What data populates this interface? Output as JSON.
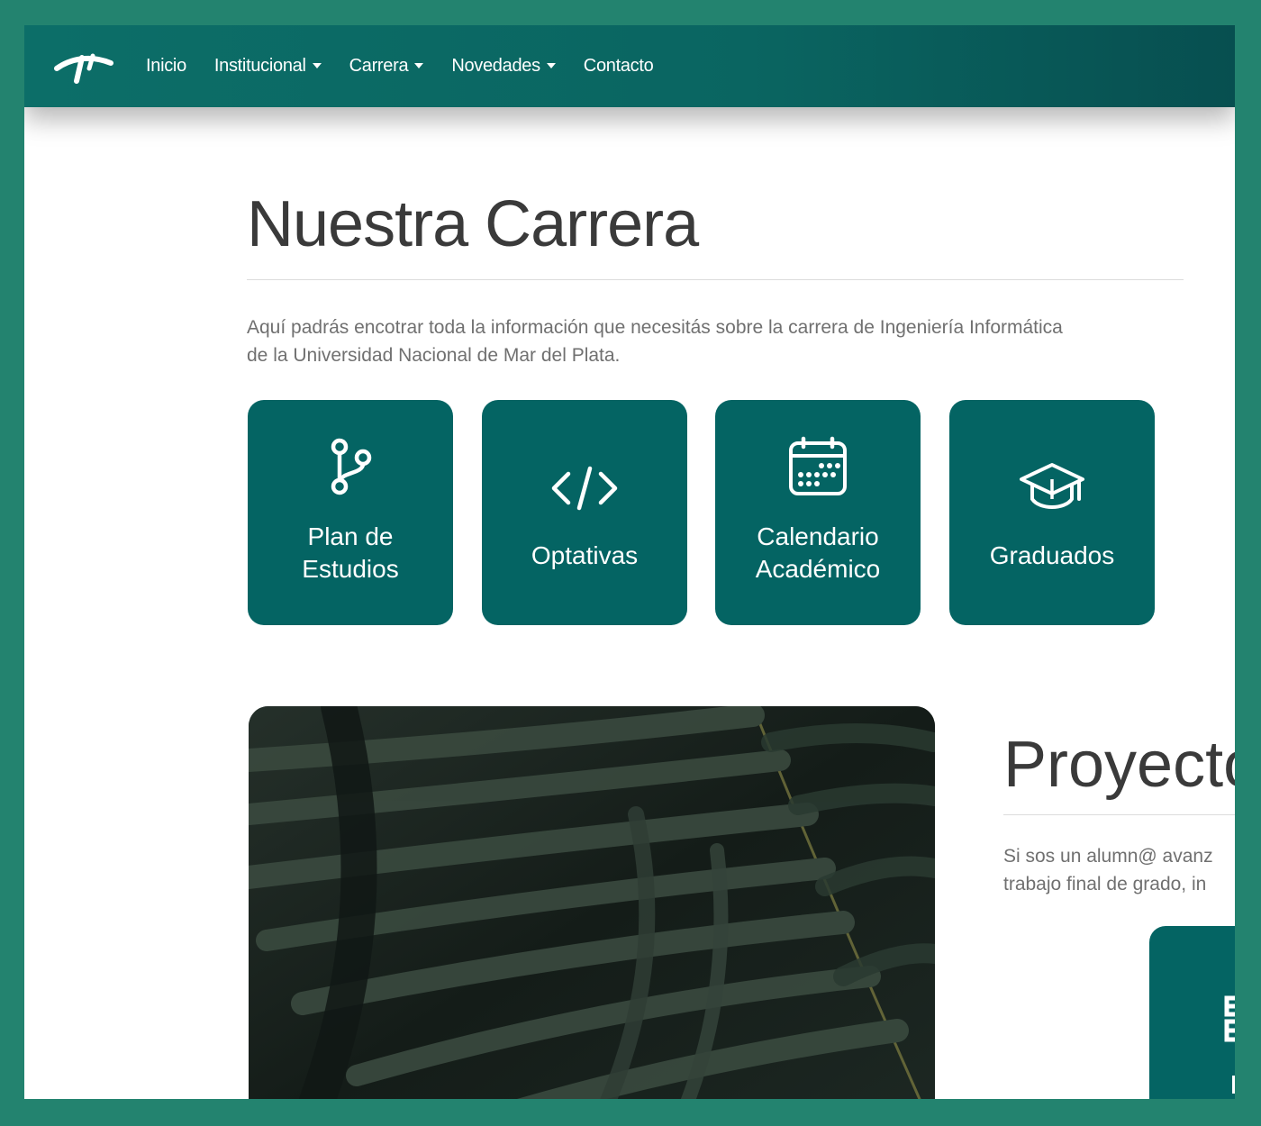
{
  "nav": {
    "logo": "logo-icon",
    "items": [
      {
        "label": "Inicio",
        "dropdown": false
      },
      {
        "label": "Institucional",
        "dropdown": true
      },
      {
        "label": "Carrera",
        "dropdown": true
      },
      {
        "label": "Novedades",
        "dropdown": true
      },
      {
        "label": "Contacto",
        "dropdown": false
      }
    ]
  },
  "main": {
    "title": "Nuestra Carrera",
    "intro_line1": "Aquí padrás encotrar toda la información que necesitás sobre la carrera de Ingeniería Informática",
    "intro_line2": "de la Universidad Nacional de Mar del Plata."
  },
  "cards": [
    {
      "line1": "Plan de",
      "line2": "Estudios",
      "icon": "git-branch-icon"
    },
    {
      "line1": "Optativas",
      "line2": "",
      "icon": "code-icon"
    },
    {
      "line1": "Calendario",
      "line2": "Académico",
      "icon": "calendar-icon"
    },
    {
      "line1": "Graduados",
      "line2": "",
      "icon": "graduation-cap-icon"
    }
  ],
  "projects": {
    "title": "Proyecto",
    "text_line1": "Si sos un alumn@ avanz",
    "text_line2": "trabajo final de grado, in"
  },
  "colors": {
    "background": "#23836f",
    "navbar": "#0a6561",
    "card": "#046463",
    "text": "#707070",
    "heading": "#3a3a3a"
  }
}
